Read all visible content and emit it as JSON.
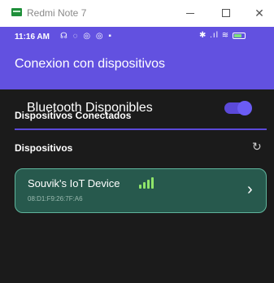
{
  "window": {
    "title": "Redmi Note 7",
    "minimize_icon": "minimize-icon",
    "maximize_icon": "maximize-icon",
    "close_label": "✕"
  },
  "status_bar": {
    "time": "11:16 AM",
    "left_icons": "☊ ◌ ◎ ◎ ▪",
    "right_icons": "✱ .ıl ≋"
  },
  "app_bar": {
    "title": "Conexion con dispositivos"
  },
  "bluetooth": {
    "label": "Bluetooth Disponibles",
    "enabled": true,
    "accent_color": "#5b49d9"
  },
  "sections": {
    "connected_title": "Dispositivos Conectados",
    "devices_title": "Dispositivos",
    "refresh_icon": "refresh-icon",
    "refresh_glyph": "↻"
  },
  "devices": [
    {
      "name": "Souvik's IoT Device",
      "mac": "08:D1:F9:26:7F:A6",
      "signal_icon": "signal-strength-icon",
      "chevron_glyph": "›"
    }
  ],
  "colors": {
    "app_bar": "#6251e0",
    "background": "#1b1b1b",
    "card": "#27594d",
    "card_border": "#5fb49c",
    "signal": "#8fe56a"
  }
}
